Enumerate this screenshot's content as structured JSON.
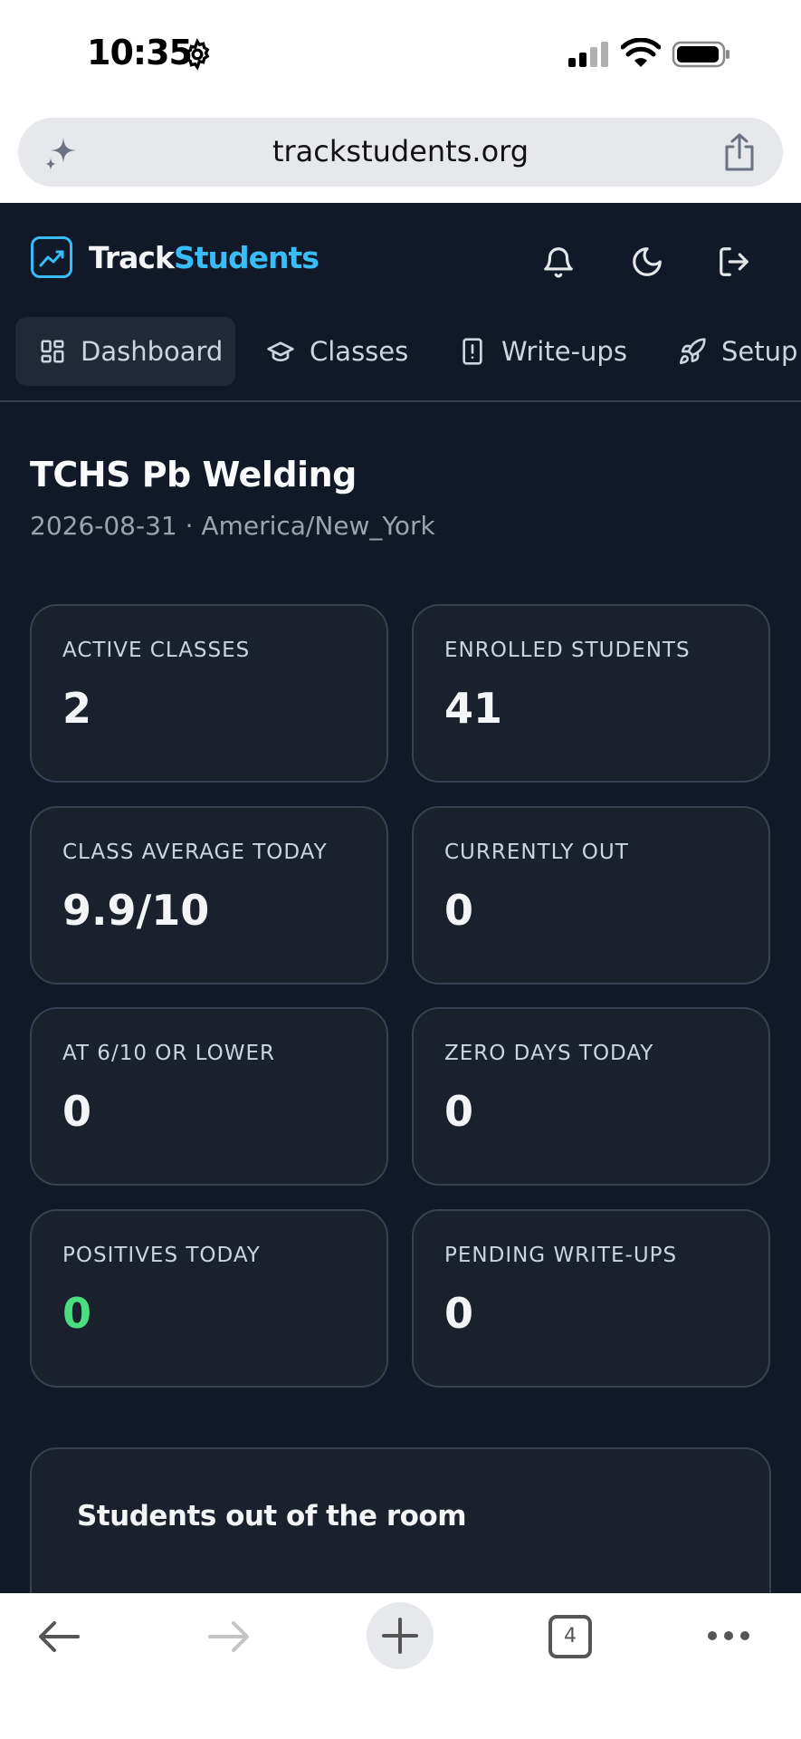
{
  "status_bar": {
    "time": "10:35"
  },
  "browser": {
    "url": "trackstudents.org",
    "tab_count": "4"
  },
  "app": {
    "logo_part1": "Track",
    "logo_part2": "Students",
    "colors": {
      "background": "#111827",
      "card": "#1a202c",
      "accent": "#38bdf8",
      "positive": "#4ade80"
    },
    "header_icons": [
      "bell-icon",
      "moon-icon",
      "logout-icon"
    ]
  },
  "nav": {
    "tabs": [
      {
        "label": "Dashboard",
        "icon": "dashboard-icon",
        "active": true
      },
      {
        "label": "Classes",
        "icon": "graduation-cap-icon",
        "active": false
      },
      {
        "label": "Write-ups",
        "icon": "alert-file-icon",
        "active": false
      },
      {
        "label": "Setup",
        "icon": "rocket-icon",
        "active": false
      }
    ]
  },
  "page": {
    "title": "TCHS Pb Welding",
    "subtitle": "2026-08-31 · America/New_York"
  },
  "stats": [
    {
      "label": "ACTIVE CLASSES",
      "value": "2"
    },
    {
      "label": "ENROLLED STUDENTS",
      "value": "41"
    },
    {
      "label": "CLASS AVERAGE TODAY",
      "value": "9.9/10"
    },
    {
      "label": "CURRENTLY OUT",
      "value": "0"
    },
    {
      "label": "AT 6/10 OR LOWER",
      "value": "0"
    },
    {
      "label": "ZERO DAYS TODAY",
      "value": "0"
    },
    {
      "label": "POSITIVES TODAY",
      "value": "0"
    },
    {
      "label": "PENDING WRITE-UPS",
      "value": "0"
    }
  ],
  "section": {
    "title": "Students out of the room"
  }
}
